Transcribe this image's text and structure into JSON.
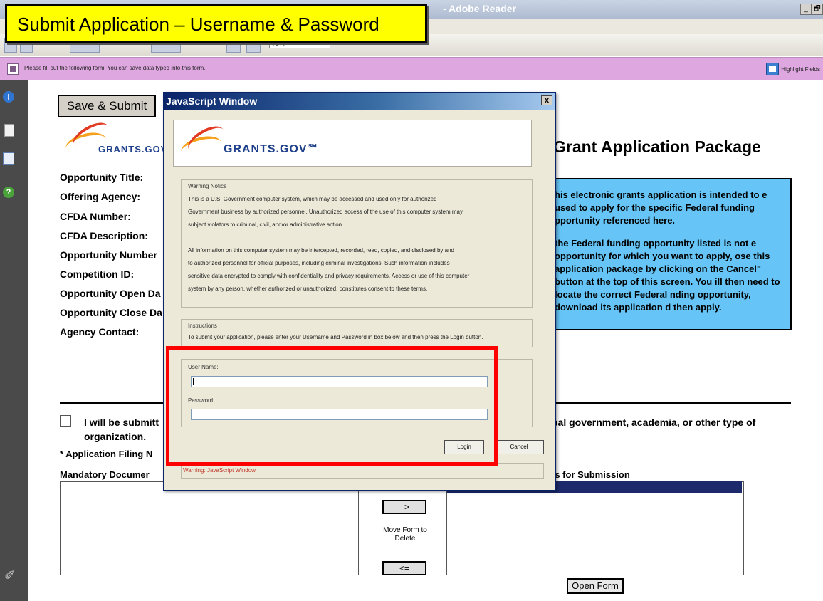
{
  "app": {
    "title": "- Adobe Reader",
    "window_controls": [
      "_",
      "🗗"
    ]
  },
  "toolbar": {
    "zoom_value": "75%"
  },
  "slide_overlay": {
    "title": "Submit Application – Username & Password"
  },
  "message_bar": {
    "text": "Please fill out the following form. You can save data typed into this form.",
    "highlight_label": "Highlight Fields"
  },
  "form": {
    "save_submit_label": "Save & Submit",
    "logo_text": "GRANTS.GOV",
    "header": "Grant Application Package",
    "fields": [
      "Opportunity Title:",
      "Offering Agency:",
      "CFDA Number:",
      "CFDA Description:",
      "Opportunity Number",
      "Competition ID:",
      "Opportunity Open Da",
      "Opportunity Close Da",
      "Agency Contact:"
    ],
    "info_box": {
      "para1": "his electronic grants application is intended to e used to apply for the specific Federal funding pportunity referenced here.",
      "para2": "the Federal funding opportunity listed is not e opportunity for which you want to apply, ose this application package by clicking on the Cancel\" button at the top of this screen. You ill then need to locate the correct Federal nding opportunity, download its application d then apply."
    },
    "checkbox_text_left": "I will be submitt",
    "checkbox_text_right": "bal government, academia, or other type of",
    "checkbox_text_line2": "organization.",
    "filing_label": "* Application Filing N",
    "mandatory_label": "Mandatory Documer",
    "optional_label": "ts for Submission",
    "move_right_label": "=>",
    "move_left_label": "<=",
    "move_form_label": "Move Form to Delete",
    "open_form_label": "Open Form"
  },
  "dialog": {
    "title": "JavaScript Window",
    "close_label": "x",
    "logo_text": "GRANTS.GOV℠",
    "warning_group_label": "Warning Notice",
    "warning_lines": [
      "This is a U.S. Government computer system, which may be accessed and used only for authorized",
      "Government business by authorized personnel. Unauthorized access of the use of this computer system may",
      "subject violators to criminal, civil, and/or administrative action.",
      "",
      "All information on this computer system may be intercepted, recorded, read, copied, and disclosed by and",
      "to authorized personnel for official purposes, including criminal investigations. Such information includes",
      "sensitive data encrypted to comply with confidentiality and privacy requirements. Access or use of this computer",
      "system by any person, whether authorized or unauthorized, constitutes consent to these terms."
    ],
    "instructions_label": "Instructions",
    "instructions_text": "To submit your application, please enter your Username and Password in box below and then press the Login button.",
    "username_label": "User Name:",
    "username_value": "",
    "password_label": "Password:",
    "password_value": "",
    "login_label": "Login",
    "cancel_label": "Cancel",
    "status_text": "Warning: JavaScript Window"
  },
  "colors": {
    "overlay_yellow": "#ffff00",
    "message_bar": "#dea7e0",
    "info_box": "#66c5f6",
    "highlight_frame": "#ff0000",
    "dialog_title": "#0a246a"
  }
}
